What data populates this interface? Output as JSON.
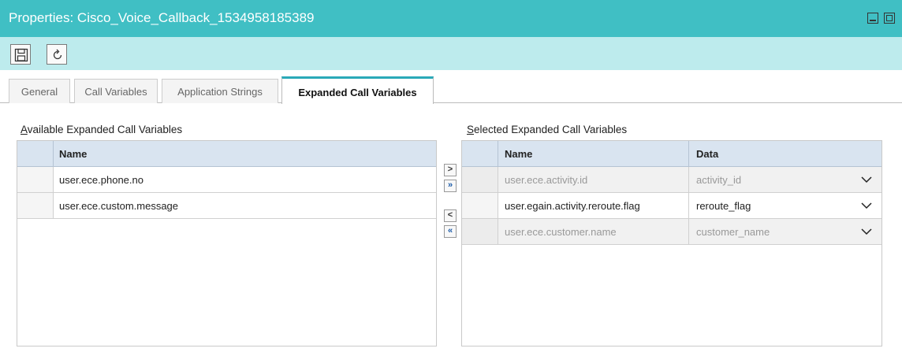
{
  "window": {
    "title": "Properties: Cisco_Voice_Callback_1534958185389"
  },
  "tabs": [
    {
      "label": "General"
    },
    {
      "label": "Call Variables"
    },
    {
      "label": "Application Strings"
    },
    {
      "label": "Expanded Call Variables",
      "active": true
    }
  ],
  "available": {
    "label_first": "A",
    "label_rest": "vailable Expanded Call Variables",
    "header": "Name",
    "rows": [
      {
        "name": "user.ece.phone.no"
      },
      {
        "name": "user.ece.custom.message"
      }
    ]
  },
  "selected": {
    "label_first": "S",
    "label_rest": "elected Expanded Call Variables",
    "header_name": "Name",
    "header_data": "Data",
    "rows": [
      {
        "name": "user.ece.activity.id",
        "data": "activity_id",
        "enabled": false
      },
      {
        "name": "user.egain.activity.reroute.flag",
        "data": "reroute_flag",
        "enabled": true
      },
      {
        "name": "user.ece.customer.name",
        "data": "customer_name",
        "enabled": false
      }
    ]
  },
  "move_buttons": {
    "add": ">",
    "add_all": "»",
    "remove": "<",
    "remove_all": "«"
  },
  "icons": {
    "save": "save-icon",
    "refresh": "refresh-icon",
    "minimize": "minimize-icon",
    "maximize": "maximize-icon",
    "dropdown": "chevron-down-icon"
  },
  "colors": {
    "titlebar": "#40bfc4",
    "toolbar": "#bdebed",
    "active_tab_accent": "#2aa9b8",
    "grid_header": "#d9e4f0"
  }
}
